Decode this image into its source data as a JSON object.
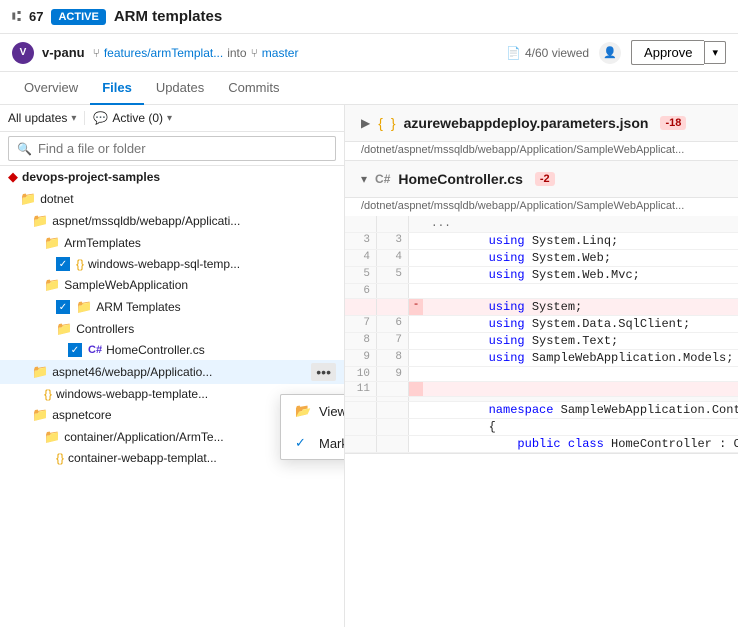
{
  "header": {
    "pr_number": "67",
    "status": "ACTIVE",
    "title": "ARM templates",
    "username": "v-panu",
    "branch_from": "features/armTemplat...",
    "branch_into": "into",
    "branch_to": "master",
    "viewed": "4/60 viewed",
    "approve_label": "Approve",
    "dropdown_arrow": "▾"
  },
  "nav": {
    "tabs": [
      {
        "label": "Overview",
        "active": false
      },
      {
        "label": "Files",
        "active": true
      },
      {
        "label": "Updates",
        "active": false
      },
      {
        "label": "Commits",
        "active": false
      }
    ]
  },
  "filters": {
    "all_updates": "All updates",
    "active_label": "Active (0)"
  },
  "search": {
    "placeholder": "Find a file or folder"
  },
  "file_tree": {
    "root": "devops-project-samples",
    "items": [
      {
        "label": "dotnet",
        "type": "folder",
        "depth": 1
      },
      {
        "label": "aspnet/mssqldb/webapp/Applicati...",
        "type": "folder",
        "depth": 2
      },
      {
        "label": "ArmTemplates",
        "type": "folder",
        "depth": 3
      },
      {
        "label": "windows-webapp-sql-temp...",
        "type": "brace",
        "depth": 4,
        "checked": true
      },
      {
        "label": "SampleWebApplication",
        "type": "folder",
        "depth": 3
      },
      {
        "label": "ARM Templates",
        "type": "folder",
        "depth": 4,
        "checked": true
      },
      {
        "label": "Controllers",
        "type": "folder",
        "depth": 4
      },
      {
        "label": "HomeController.cs",
        "type": "cs",
        "depth": 5,
        "checked": true
      },
      {
        "label": "aspnet46/webapp/Applicatio...",
        "type": "folder",
        "depth": 2,
        "has_menu": true
      },
      {
        "label": "windows-webapp-template...",
        "type": "brace",
        "depth": 3
      },
      {
        "label": "aspnetcore",
        "type": "folder",
        "depth": 2
      },
      {
        "label": "container/Application/ArmTe...",
        "type": "folder",
        "depth": 3
      },
      {
        "label": "container-webapp-templat...",
        "type": "brace",
        "depth": 4
      }
    ]
  },
  "context_menu": {
    "items": [
      {
        "label": "View in file explorer",
        "icon": "folder"
      },
      {
        "label": "Mark as reviewed",
        "icon": "check",
        "checked": true
      }
    ]
  },
  "diff_files": [
    {
      "id": "file1",
      "collapsed": true,
      "name": "{ }",
      "full_name": "azurewebappdeploy.parameters.json",
      "diff": "-18",
      "path": "/dotnet/aspnet/mssqldb/webapp/Application/SampleWebApplicat..."
    },
    {
      "id": "file2",
      "collapsed": false,
      "lang": "C#",
      "name": "HomeController.cs",
      "diff": "-2",
      "path": "/dotnet/aspnet/mssqldb/webapp/Application/SampleWebApplicat...",
      "lines": [
        {
          "old_num": "",
          "new_num": "",
          "type": "dots",
          "content": "..."
        },
        {
          "old_num": "3",
          "new_num": "3",
          "type": "normal",
          "content": "        using System.Linq;"
        },
        {
          "old_num": "4",
          "new_num": "4",
          "type": "normal",
          "content": "        using System.Web;"
        },
        {
          "old_num": "5",
          "new_num": "5",
          "type": "normal",
          "content": "        using System.Web.Mvc;"
        },
        {
          "old_num": "6",
          "new_num": "",
          "type": "normal",
          "content": ""
        },
        {
          "old_num": "",
          "new_num": "",
          "type": "removed",
          "content": "        using System;",
          "marker": "-"
        },
        {
          "old_num": "7",
          "new_num": "6",
          "type": "normal",
          "content": "        using System.Data.SqlClient;"
        },
        {
          "old_num": "8",
          "new_num": "7",
          "type": "normal",
          "content": "        using System.Text;"
        },
        {
          "old_num": "9",
          "new_num": "8",
          "type": "normal",
          "content": "        using SampleWebApplication.Models;"
        },
        {
          "old_num": "10",
          "new_num": "9",
          "type": "normal",
          "content": ""
        },
        {
          "old_num": "11",
          "new_num": "",
          "type": "normal",
          "content": ""
        },
        {
          "old_num": "",
          "new_num": "",
          "type": "dots2",
          "content": ""
        },
        {
          "old_num": "",
          "new_num": "",
          "type": "normal2",
          "content": "        namespace SampleWebApplication.Contro..."
        },
        {
          "old_num": "",
          "new_num": "",
          "type": "normal2",
          "content": "        {"
        },
        {
          "old_num": "",
          "new_num": "",
          "type": "normal2",
          "content": "            public class HomeController : Co..."
        }
      ]
    }
  ]
}
